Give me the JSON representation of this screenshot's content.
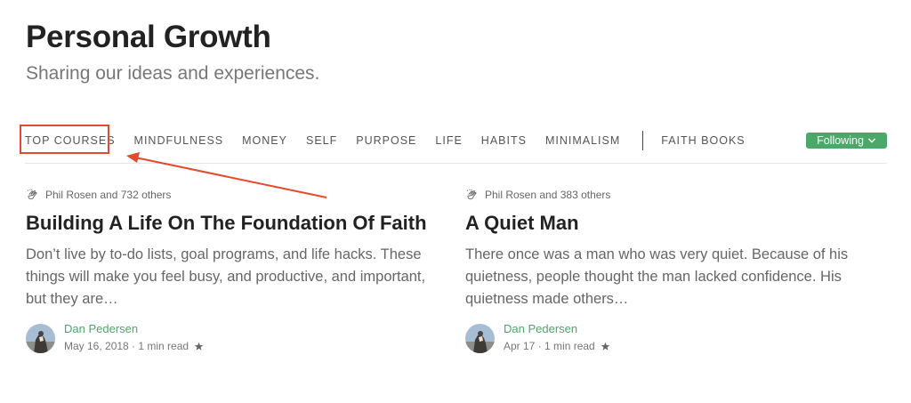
{
  "publication": {
    "title": "Personal Growth",
    "subtitle": "Sharing our ideas and experiences."
  },
  "nav": {
    "items": [
      "TOP COURSES",
      "MINDFULNESS",
      "MONEY",
      "SELF",
      "PURPOSE",
      "LIFE",
      "HABITS",
      "MINIMALISM"
    ],
    "after_separator": "FAITH BOOKS",
    "follow_label": "Following"
  },
  "colors": {
    "accent": "#4ca869",
    "highlight": "#e34a2e"
  },
  "articles": [
    {
      "claps": "Phil Rosen and 732 others",
      "title": "Building A Life On The Foundation Of Faith",
      "excerpt": "Don’t live by to-do lists, goal programs, and life hacks. These things will make you feel busy, and productive, and important, but they are…",
      "author": "Dan Pedersen",
      "meta": "May 16, 2018 · 1 min read"
    },
    {
      "claps": "Phil Rosen and 383 others",
      "title": "A Quiet Man",
      "excerpt": "There once was a man who was very quiet. Because of his quietness, people thought the man lacked confidence. His quietness made others…",
      "author": "Dan Pedersen",
      "meta": "Apr 17 · 1 min read"
    }
  ]
}
